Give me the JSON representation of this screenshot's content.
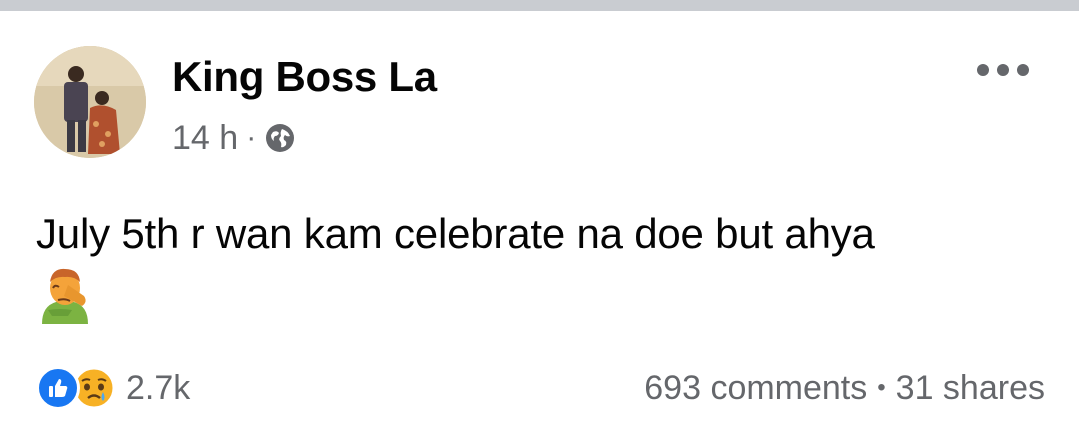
{
  "post": {
    "author": "King Boss La",
    "time": "14 h",
    "separator": "·",
    "audience_icon": "globe-icon",
    "text": "July 5th r wan kam celebrate na doe but ahya",
    "emoji_icon": "man-facepalming-icon",
    "reactions": {
      "icons": [
        "like-icon",
        "sad-icon"
      ],
      "count": "2.7k"
    },
    "comments": "693 comments",
    "dot": "•",
    "shares": "31 shares"
  },
  "colors": {
    "like_blue": "#1877f2",
    "secondary_text": "#65676b",
    "divider": "#c9ccd1"
  }
}
